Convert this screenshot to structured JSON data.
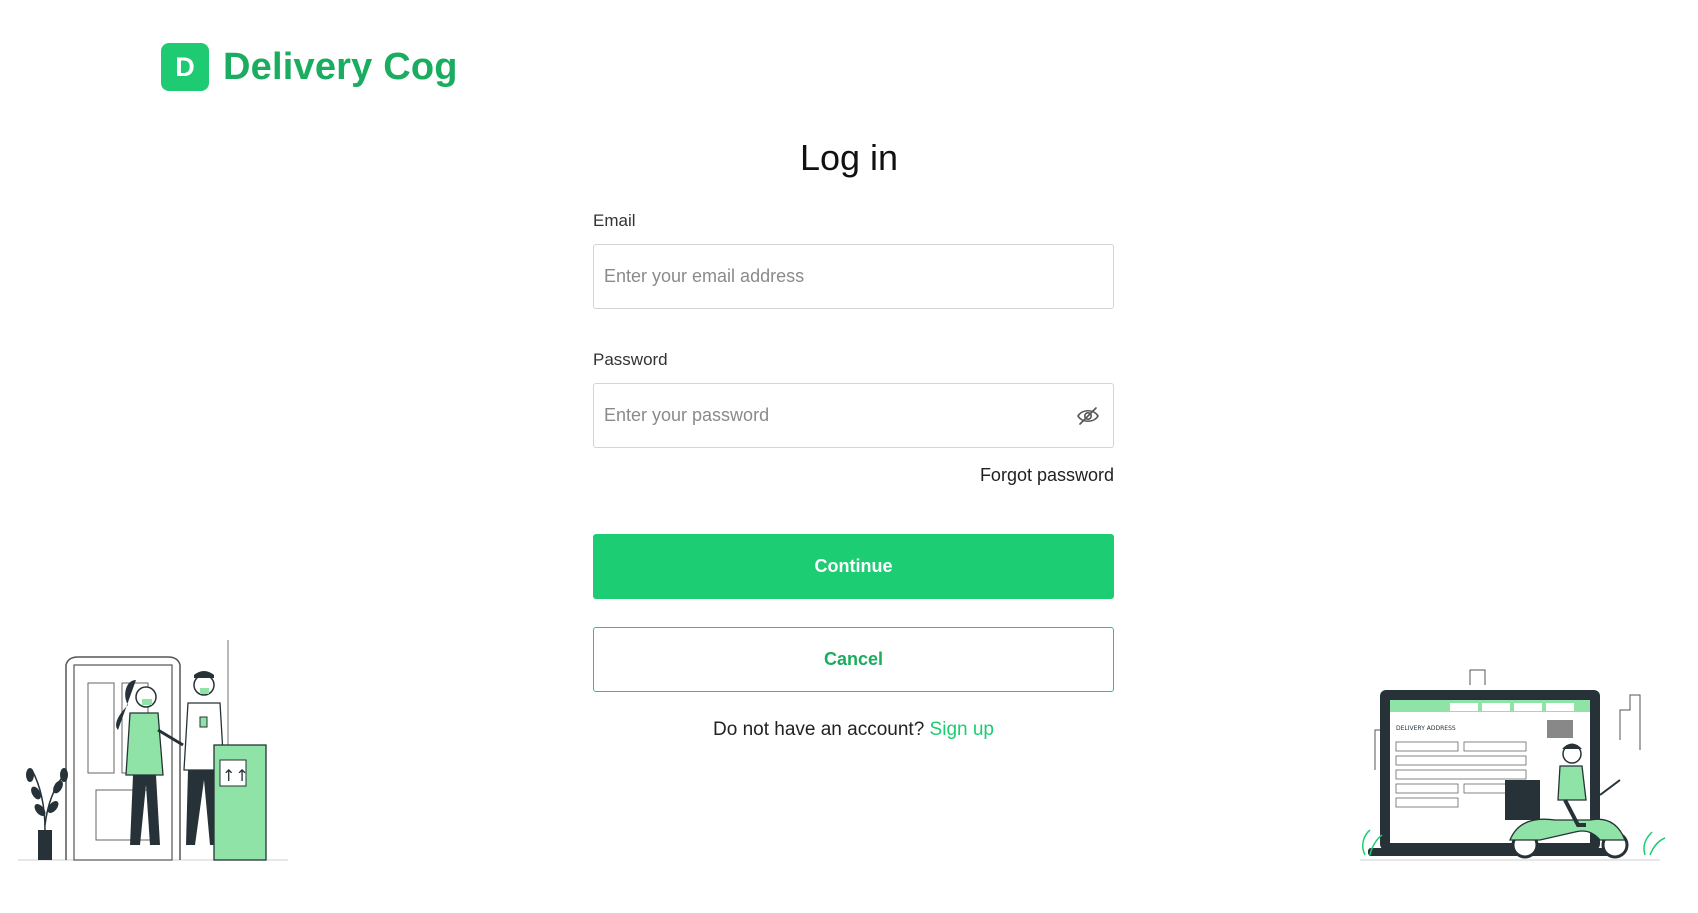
{
  "brand": {
    "mark": "D",
    "name": "Delivery Cog"
  },
  "page": {
    "title": "Log in"
  },
  "form": {
    "email_label": "Email",
    "email_placeholder": "Enter your email address",
    "password_label": "Password",
    "password_placeholder": "Enter your password",
    "password_toggle_icon": "eye-off-icon",
    "forgot_label": "Forgot password",
    "continue_label": "Continue",
    "cancel_label": "Cancel",
    "signup_prompt": "Do not have an account?",
    "signup_link": "Sign up"
  },
  "illustration_right": {
    "header_text": "DELIVERY ADDRESS"
  },
  "colors": {
    "brand_green": "#1dcd74",
    "brand_text": "#1aad5f",
    "light_green": "#90e3a6",
    "dark": "#263238"
  }
}
